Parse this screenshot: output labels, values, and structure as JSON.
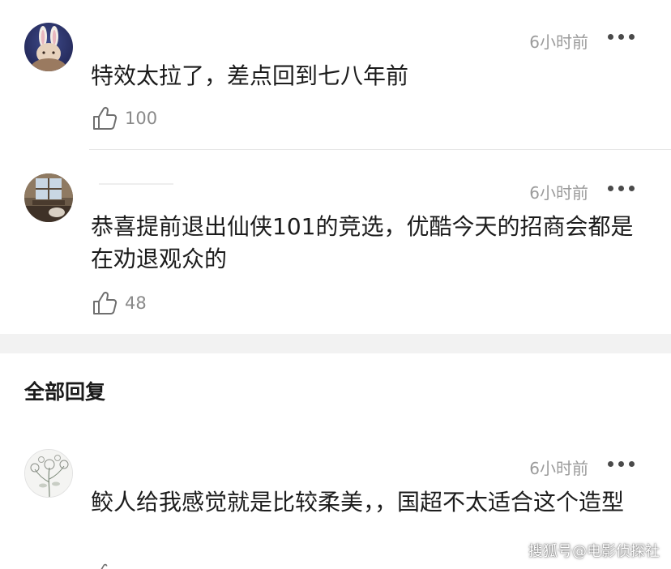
{
  "comments": [
    {
      "avatar": "rabbit-ears-avatar",
      "time": "6小时前",
      "text": "特效太拉了，差点回到七八年前",
      "likes": "100"
    },
    {
      "avatar": "window-scene-avatar",
      "time": "6小时前",
      "text": "恭喜提前退出仙侠101的竞选，优酷今天的招商会都是在劝退观众的",
      "likes": "48"
    }
  ],
  "section_title": "全部回复",
  "replies": [
    {
      "avatar": "flower-sketch-avatar",
      "time": "6小时前",
      "text": "鲛人给我感觉就是比较柔美，，国超不太适合这个造型"
    }
  ],
  "watermark": "搜狐号@电影侦探社",
  "colors": {
    "time": "#9b9b9b",
    "like_count": "#8a8a8a",
    "divider": "#e6e6e6",
    "section_gap": "#f2f2f2"
  },
  "icons": {
    "like": "thumbs-up-icon",
    "more": "more-dots-icon"
  }
}
